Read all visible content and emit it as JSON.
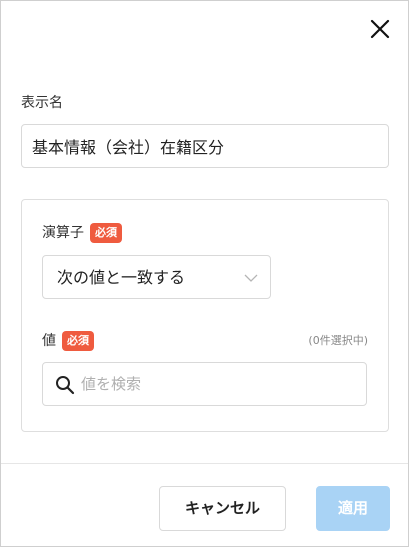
{
  "dialog": {
    "display_name": {
      "label": "表示名",
      "value": "基本情報（会社）在籍区分"
    },
    "filter": {
      "operator": {
        "label": "演算子",
        "required_badge": "必須",
        "selected": "次の値と一致する"
      },
      "value": {
        "label": "値",
        "required_badge": "必須",
        "selected_count": "(0件選択中)",
        "search_placeholder": "値を検索",
        "search_value": ""
      }
    },
    "buttons": {
      "cancel": "キャンセル",
      "apply": "適用"
    }
  },
  "icons": {
    "close": "close-icon",
    "chevron": "chevron-down-icon",
    "search": "search-icon"
  },
  "colors": {
    "required_badge": "#ef5b3f",
    "apply_button_disabled": "#a9d3f5",
    "border": "#d9d9d9"
  }
}
